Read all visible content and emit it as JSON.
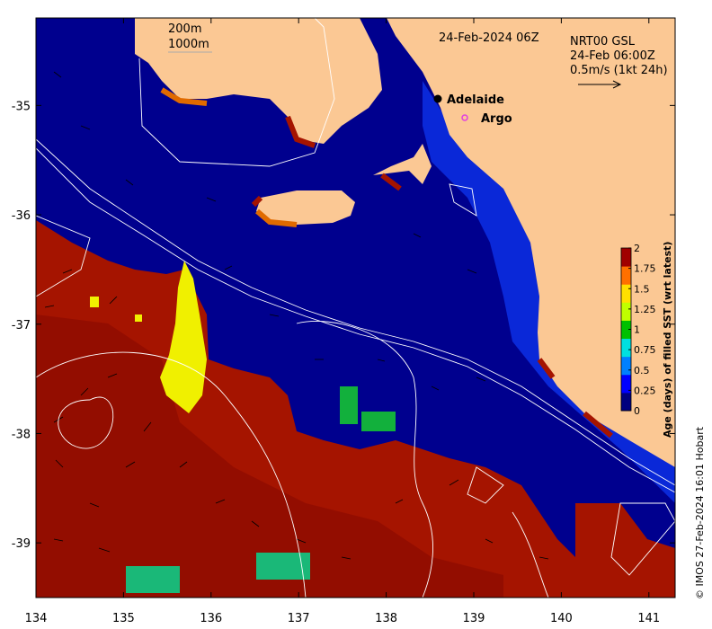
{
  "map": {
    "title": "24-Feb-2024 06Z",
    "product_lines": [
      "NRT00 GSL",
      "24-Feb 06:00Z",
      "0.5m/s (1kt 24h)"
    ],
    "depth_legend": [
      "200m",
      "1000m"
    ],
    "places": [
      {
        "name": "Adelaide",
        "lon": 138.6,
        "lat": -34.93,
        "marker": "filled-circle",
        "color": "#000000"
      },
      {
        "name": "Argo",
        "lon": 138.87,
        "lat": -35.12,
        "marker": "open-circle",
        "color": "#e040e0"
      }
    ],
    "x_ticks": [
      134,
      135,
      136,
      137,
      138,
      139,
      140,
      141
    ],
    "y_ticks": [
      -35,
      -36,
      -37,
      -38,
      -39
    ],
    "lon_range": [
      134,
      141.3
    ],
    "lat_range": [
      -39.5,
      -34.2
    ],
    "colorbar": {
      "label": "Age (days) of filled SST (wrt latest)",
      "ticks": [
        "0",
        "0.25",
        "0.5",
        "0.75",
        "1",
        "1.25",
        "1.5",
        "1.75",
        "2"
      ],
      "range": [
        0,
        2
      ],
      "colors": [
        "#00007f",
        "#0000ff",
        "#0080ff",
        "#00e0e0",
        "#00c000",
        "#c0ff00",
        "#ffe000",
        "#ff7000",
        "#a00000"
      ]
    },
    "credit": "© IMOS 27-Feb-2024 16:01 Hobart",
    "colors": {
      "land": "#fbc894",
      "ocean": "#00008e",
      "nearshore": "#0a28d8",
      "old": "#a51400",
      "old_dark": "#8c0a00",
      "yellow": "#f0f000",
      "green": "#12b03c",
      "teal": "#1ab878",
      "orange": "#e06a00"
    }
  }
}
